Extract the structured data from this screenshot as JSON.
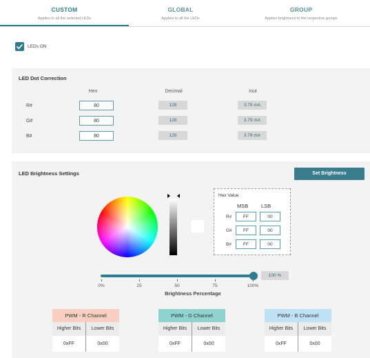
{
  "tabs": [
    {
      "title": "CUSTOM",
      "subtitle": "Applies to all the selected LEDs",
      "active": true
    },
    {
      "title": "GLOBAL",
      "subtitle": "Applies to all the LEDs",
      "active": false
    },
    {
      "title": "GROUP",
      "subtitle": "Applies brightness to the respective groups",
      "active": false
    }
  ],
  "leds_on": {
    "label": "LEDs ON",
    "checked": true
  },
  "dot_correction": {
    "title": "LED Dot Correction",
    "headers": {
      "hex": "Hex",
      "decimal": "Decimal",
      "iout": "Iout"
    },
    "rows": [
      {
        "label": "R#",
        "hex": "80",
        "decimal": "128",
        "iout": "3.79 mA"
      },
      {
        "label": "G#",
        "hex": "80",
        "decimal": "128",
        "iout": "3.79 mA"
      },
      {
        "label": "B#",
        "hex": "80",
        "decimal": "128",
        "iout": "3.79 mA"
      }
    ]
  },
  "brightness": {
    "title": "LED Brightness Settings",
    "set_button": "Set Brightness",
    "hex_value": {
      "title": "Hex Value",
      "msb": "MSB",
      "lsb": "LSB",
      "rows": [
        {
          "label": "R#",
          "msb": "FF",
          "lsb": "00"
        },
        {
          "label": "G#",
          "msb": "FF",
          "lsb": "00"
        },
        {
          "label": "B#",
          "msb": "FF",
          "lsb": "00"
        }
      ]
    },
    "slider": {
      "value_percent": 100,
      "readout": "100 %",
      "ticks": [
        "0%",
        "25",
        "50",
        "75",
        "100%"
      ],
      "label": "Brightness Percentage"
    },
    "pwm": [
      {
        "title": "PWM - R Channel",
        "color": "#f8cfc0",
        "higher_label": "Higher Bits",
        "lower_label": "Lower Bits",
        "higher": "0xFF",
        "lower": "0x00"
      },
      {
        "title": "PWM - G Channel",
        "color": "#8fd3cf",
        "higher_label": "Higher Bits",
        "lower_label": "Lower Bits",
        "higher": "0xFF",
        "lower": "0x00"
      },
      {
        "title": "PWM - B Channel",
        "color": "#bfe1f6",
        "higher_label": "Higher Bits",
        "lower_label": "Lower Bits",
        "higher": "0xFF",
        "lower": "0x00"
      }
    ]
  },
  "colors": {
    "accent": "#2e7c8f",
    "panel": "#f3f3f3",
    "readonly": "#d8d8d8"
  }
}
